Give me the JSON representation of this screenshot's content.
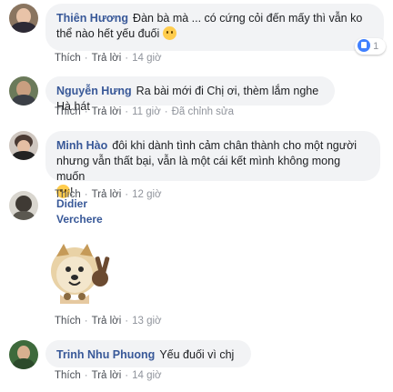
{
  "comments": [
    {
      "author": "Thiên Hương",
      "text": "Đàn bà mà ... có cứng cỏi đến mấy thì vẫn ko thể nào hết yếu đuối",
      "like": "Thích",
      "reply": "Trả lời",
      "time": "14 giờ",
      "reaction_count": "1"
    },
    {
      "author": "Nguyễn Hưng",
      "text": "Ra bài mới đi Chị ơi, thèm lắm nghe Hà hát",
      "like": "Thích",
      "reply": "Trả lời",
      "time": "11 giờ",
      "edited": "Đã chỉnh sửa"
    },
    {
      "author": "Minh Hào",
      "text": "đôi khi dành tình cảm chân thành cho một người nhưng vẫn thất bại, vẫn là một cái kết mình không mong muốn",
      "text_end": "!",
      "like": "Thích",
      "reply": "Trả lời",
      "time": "12 giờ"
    },
    {
      "author": "Didier Verchere",
      "like": "Thích",
      "reply": "Trả lời",
      "time": "13 giờ",
      "sticker": "shiba-dog-peace-sticker"
    },
    {
      "author": "Trinh Nhu Phuong",
      "text": "Yếu đuối vì chj",
      "like": "Thích",
      "reply": "Trả lời",
      "time": "14 giờ"
    }
  ],
  "colors": {
    "author": "#385898",
    "bubble": "#f2f3f5",
    "meta": "#90949c",
    "like_blue": "#4080ff"
  },
  "icons": [
    "like-icon",
    "emoji-icon"
  ]
}
